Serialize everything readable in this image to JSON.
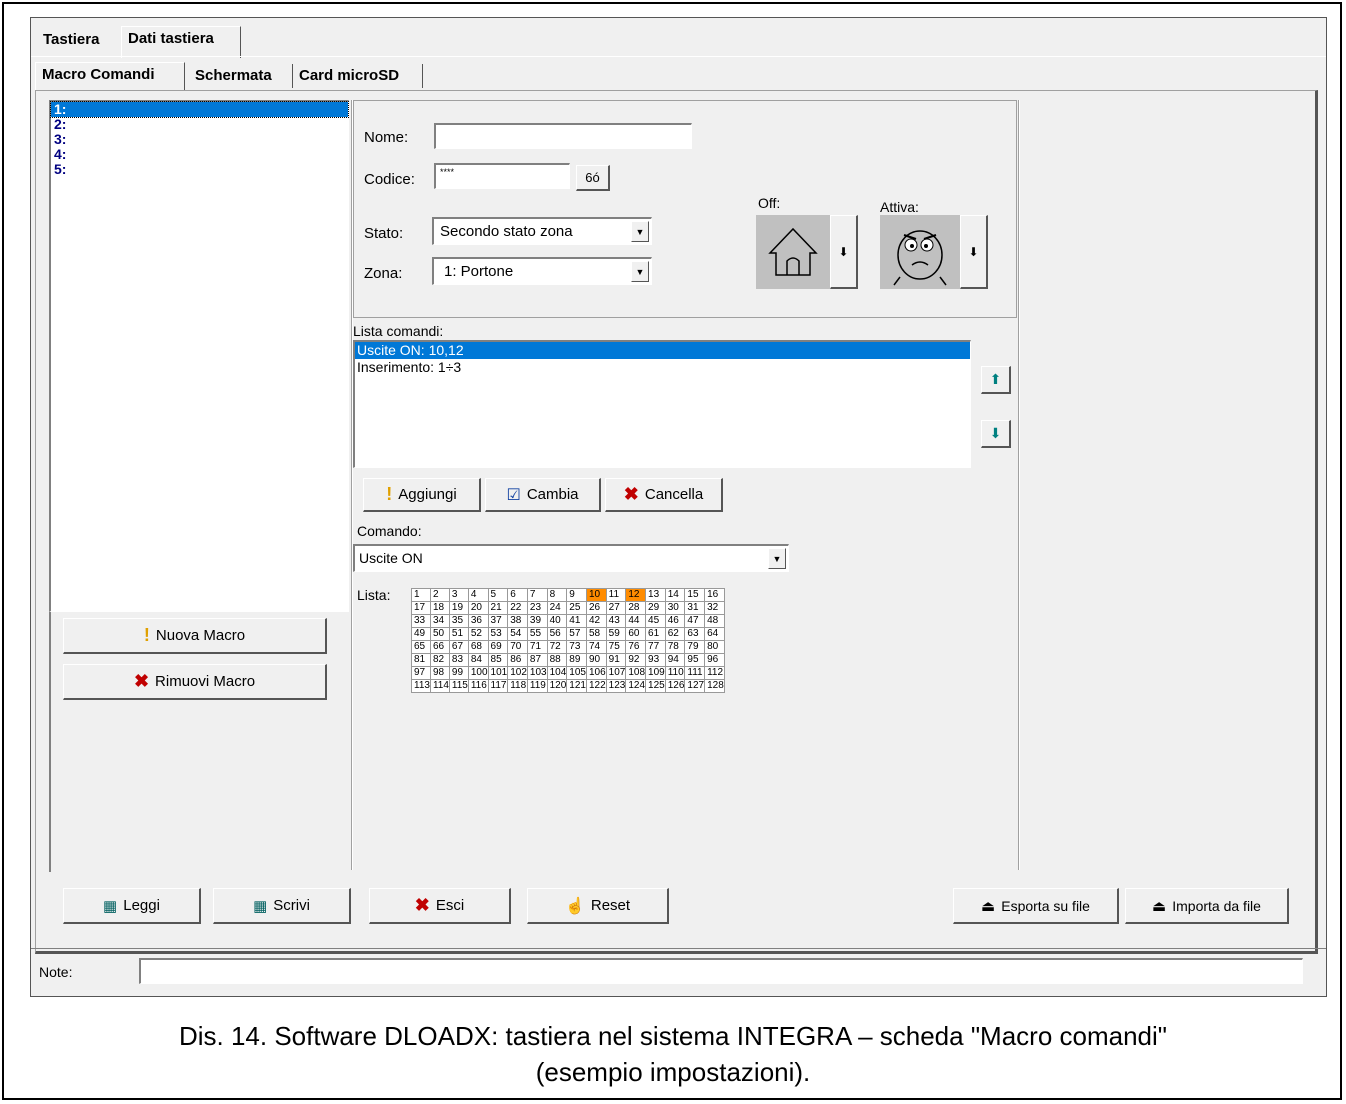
{
  "top_tabs": [
    "Tastiera",
    "Dati tastiera"
  ],
  "sub_tabs": [
    "Macro Comandi",
    "Schermata",
    "Card microSD"
  ],
  "macros": [
    "1:",
    "2:",
    "3:",
    "4:",
    "5:"
  ],
  "left_buttons": {
    "new": "Nuova Macro",
    "remove": "Rimuovi Macro"
  },
  "form": {
    "name_label": "Nome:",
    "name_value": "",
    "code_label": "Codice:",
    "code_value": "****",
    "code_toggle": "6ó",
    "state_label": "Stato:",
    "state_value": "Secondo stato zona",
    "zone_label": "Zona:",
    "zone_value": "1: Portone",
    "off_label": "Off:",
    "active_label": "Attiva:"
  },
  "commands": {
    "label": "Lista comandi:",
    "items": [
      "Uscite ON: 10,12",
      "Inserimento: 1÷3"
    ],
    "selected_index": 0
  },
  "command_buttons": {
    "add": "Aggiungi",
    "change": "Cambia",
    "delete": "Cancella"
  },
  "command_select": {
    "label": "Comando:",
    "value": "Uscite ON"
  },
  "grid": {
    "label": "Lista:",
    "rows": [
      [
        "1",
        "2",
        "3",
        "4",
        "5",
        "6",
        "7",
        "8",
        "9",
        "10",
        "11",
        "12",
        "13",
        "14",
        "15",
        "16"
      ],
      [
        "17",
        "18",
        "19",
        "20",
        "21",
        "22",
        "23",
        "24",
        "25",
        "26",
        "27",
        "28",
        "29",
        "30",
        "31",
        "32"
      ],
      [
        "33",
        "34",
        "35",
        "36",
        "37",
        "38",
        "39",
        "40",
        "41",
        "42",
        "43",
        "44",
        "45",
        "46",
        "47",
        "48"
      ],
      [
        "49",
        "50",
        "51",
        "52",
        "53",
        "54",
        "55",
        "56",
        "57",
        "58",
        "59",
        "60",
        "61",
        "62",
        "63",
        "64"
      ],
      [
        "65",
        "66",
        "67",
        "68",
        "69",
        "70",
        "71",
        "72",
        "73",
        "74",
        "75",
        "76",
        "77",
        "78",
        "79",
        "80"
      ],
      [
        "81",
        "82",
        "83",
        "84",
        "85",
        "86",
        "87",
        "88",
        "89",
        "90",
        "91",
        "92",
        "93",
        "94",
        "95",
        "96"
      ],
      [
        "97",
        "98",
        "99",
        "100",
        "101",
        "102",
        "103",
        "104",
        "105",
        "106",
        "107",
        "108",
        "109",
        "110",
        "111",
        "112"
      ],
      [
        "113",
        "114",
        "115",
        "116",
        "117",
        "118",
        "119",
        "120",
        "121",
        "122",
        "123",
        "124",
        "125",
        "126",
        "127",
        "128"
      ]
    ],
    "highlighted": [
      "10",
      "12"
    ],
    "highlight_color": "#ff8c00"
  },
  "bottom_buttons": {
    "read": "Leggi",
    "write": "Scrivi",
    "exit": "Esci",
    "reset": "Reset",
    "export": "Esporta su file",
    "import": "Importa da file"
  },
  "note_label": "Note:",
  "note_value": "",
  "caption_line1": "Dis. 14. Software DLOADX: tastiera nel sistema INTEGRA – scheda \"Macro comandi\"",
  "caption_line2": "(esempio impostazioni).",
  "colors": {
    "selection": "#0078d7",
    "window": "#f0f0f0",
    "list_text": "#000080",
    "red_x": "#c00000"
  }
}
